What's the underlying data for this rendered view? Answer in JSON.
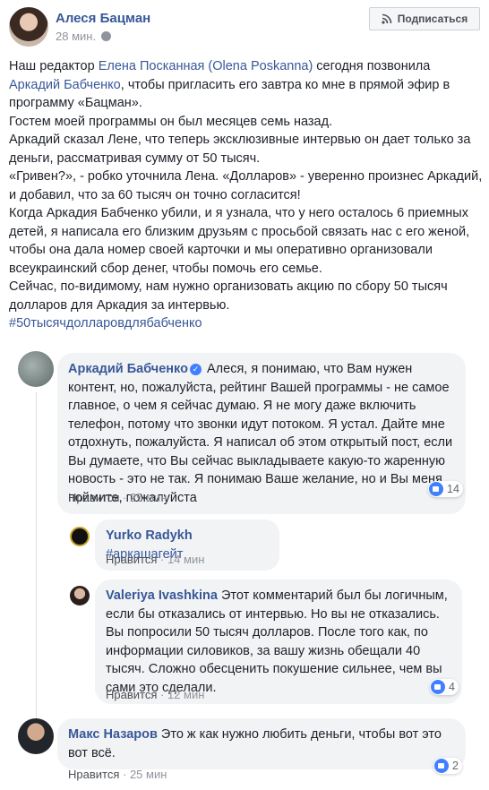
{
  "post": {
    "author": "Алеся Бацман",
    "time": "28 мин.",
    "subscribe_label": "Подписаться",
    "line1_a": "Наш редактор ",
    "line1_link": "Елена Посканная (Olena Poskanna)",
    "line1_b": " сегодня позвонила",
    "line2_link": "Аркадий Бабченко",
    "line2_b": ", чтобы пригласить его завтра ко мне в прямой эфир в программу «Бацман».",
    "para2": "Гостем моей программы он был месяцев семь назад.",
    "para3": "Аркадий сказал Лене, что теперь эксклюзивные интервью он дает только за деньги, рассматривая сумму от 50 тысяч.",
    "para4": "«Гривен?», - робко уточнила Лена. «Долларов» - уверенно произнес Аркадий, и добавил, что за 60 тысяч он точно согласится!",
    "para5": "Когда Аркадия Бабченко убили, и я узнала, что у него осталось 6 приемных детей, я написала его близким друзьям с просьбой связать нас с его женой, чтобы она дала номер своей карточки и мы оперативно организовали всеукраинский сбор денег, чтобы помочь его семье.",
    "para6": "Сейчас, по-видимому, нам нужно организовать акцию по сбору 50 тысяч долларов для Аркадия за интервью.",
    "hashtag": "#50тысячдолларовдлябабченко"
  },
  "comments": [
    {
      "name": "Аркадий Бабченко",
      "text": " Алеся, я понимаю, что Вам нужен контент, но, пожалуйста, рейтинг Вашей программы - не самое главное, о чем я сейчас думаю. Я не могу даже включить телефон, потому что звонки идут потоком. Я устал. Дайте мне отдохнуть, пожалуйста. Я написал об этом открытый пост, если Вы думаете, что Вы сейчас выкладываете какую-то жаренную новость - это не так. Я понимаю Ваше желание, но и Вы меня поймите, пожалуйста",
      "like": "Нравится",
      "time": "25 мин",
      "reactions": "14"
    },
    {
      "name": "Yurko Radykh",
      "text": " #аркашагейт",
      "like": "Нравится",
      "time": "14 мин"
    },
    {
      "name": "Valeriya Ivashkina",
      "text": " Этот комментарий был бы логичным, если бы отказались от интервью. Но вы не отказались. Вы попросили 50 тысяч долларов. После того как, по информации силовиков, за вашу жизнь обещали 40 тысяч. Сложно обесценить покушение сильнее, чем вы сами это сделали.",
      "like": "Нравится",
      "time": "12 мин",
      "reactions": "4"
    },
    {
      "name": "Макс Назаров",
      "text": " Это ж как нужно любить деньги, чтобы вот это вот всё.",
      "like": "Нравится",
      "time": "25 мин",
      "reactions": "2"
    }
  ],
  "colors": {
    "link": "#385898",
    "bubble": "#f2f3f5",
    "meta": "#90949c",
    "like": "#4080ff"
  },
  "icons": [
    "globe-icon",
    "rss-icon",
    "verified-icon",
    "like-reaction-icon"
  ]
}
